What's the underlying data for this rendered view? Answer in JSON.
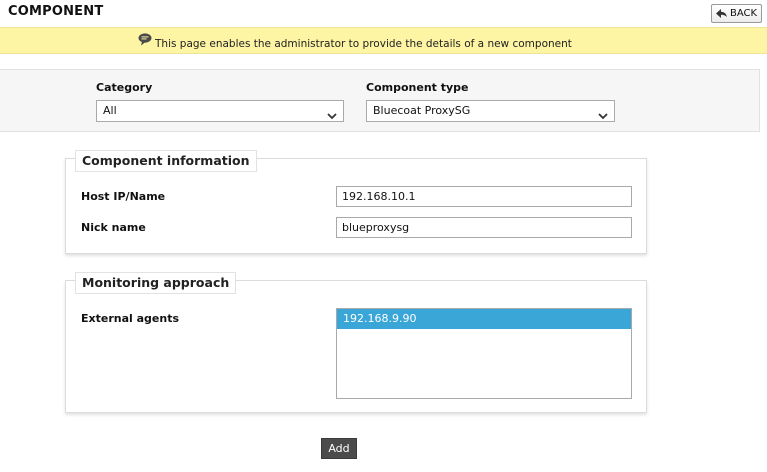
{
  "header": {
    "title": "COMPONENT",
    "back_label": "BACK"
  },
  "info_bar": {
    "message": "This page enables the administrator to provide the details of a new component",
    "icon": "speech-bubble-icon"
  },
  "filters": {
    "category_label": "Category",
    "category_value": "All",
    "component_type_label": "Component type",
    "component_type_value": "Bluecoat ProxySG"
  },
  "component_info": {
    "legend": "Component information",
    "host_label": "Host IP/Name",
    "host_value": "192.168.10.1",
    "nick_label": "Nick name",
    "nick_value": "blueproxysg"
  },
  "monitoring": {
    "legend": "Monitoring approach",
    "agents_label": "External agents",
    "agents": [
      "192.168.9.90"
    ],
    "selected_agent_index": 0
  },
  "actions": {
    "add_label": "Add"
  },
  "colors": {
    "info_bar_bg": "#fdf4a4",
    "selected_item_bg": "#3aa6d8",
    "add_button_bg": "#4b4b4b"
  }
}
